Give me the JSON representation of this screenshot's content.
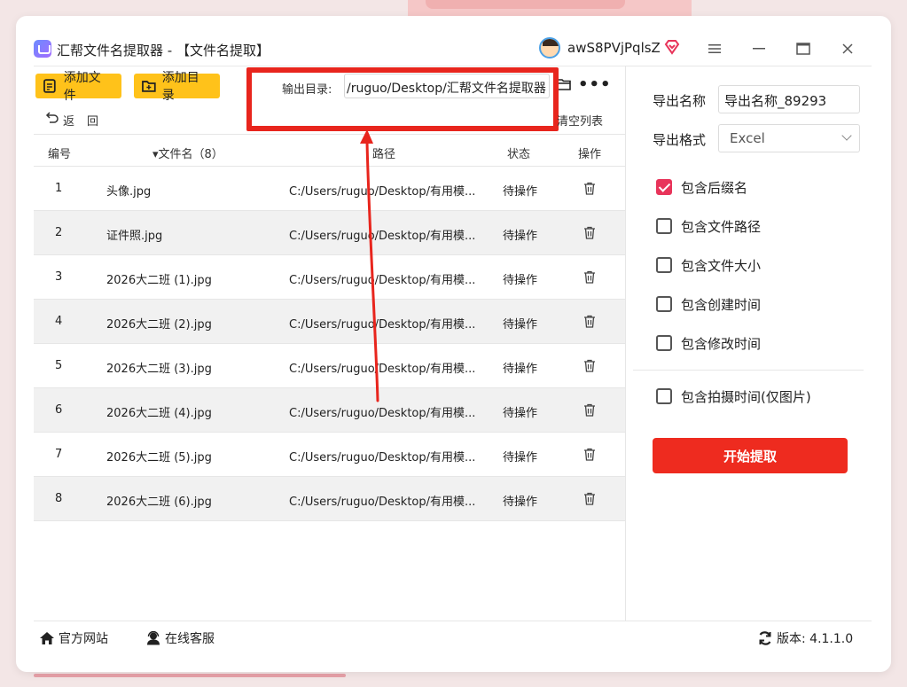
{
  "window": {
    "title": "汇帮文件名提取器 - 【文件名提取】",
    "username": "awS8PVjPqlsZ"
  },
  "toolbar": {
    "add_file": "添加文件",
    "add_dir": "添加目录",
    "output_label": "输出目录:",
    "output_value": "/ruguo/Desktop/汇帮文件名提取器",
    "more": "•••",
    "back": "返回",
    "clear_list": "清空列表"
  },
  "table": {
    "headers": {
      "no": "编号",
      "name": "▾文件名（8）",
      "path": "路径",
      "status": "状态",
      "op": "操作"
    },
    "rows": [
      {
        "no": "1",
        "name": "头像.jpg",
        "path": "C:/Users/ruguo/Desktop/有用模...",
        "status": "待操作"
      },
      {
        "no": "2",
        "name": "证件照.jpg",
        "path": "C:/Users/ruguo/Desktop/有用模...",
        "status": "待操作"
      },
      {
        "no": "3",
        "name": "2026大二班 (1).jpg",
        "path": "C:/Users/ruguo/Desktop/有用模...",
        "status": "待操作"
      },
      {
        "no": "4",
        "name": "2026大二班 (2).jpg",
        "path": "C:/Users/ruguo/Desktop/有用模...",
        "status": "待操作"
      },
      {
        "no": "5",
        "name": "2026大二班 (3).jpg",
        "path": "C:/Users/ruguo/Desktop/有用模...",
        "status": "待操作"
      },
      {
        "no": "6",
        "name": "2026大二班 (4).jpg",
        "path": "C:/Users/ruguo/Desktop/有用模...",
        "status": "待操作"
      },
      {
        "no": "7",
        "name": "2026大二班 (5).jpg",
        "path": "C:/Users/ruguo/Desktop/有用模...",
        "status": "待操作"
      },
      {
        "no": "8",
        "name": "2026大二班 (6).jpg",
        "path": "C:/Users/ruguo/Desktop/有用模...",
        "status": "待操作"
      }
    ]
  },
  "settings": {
    "export_name_label": "导出名称",
    "export_name_value": "导出名称_89293",
    "export_format_label": "导出格式",
    "export_format_value": "Excel",
    "options": [
      {
        "label": "包含后缀名",
        "checked": true
      },
      {
        "label": "包含文件路径",
        "checked": false
      },
      {
        "label": "包含文件大小",
        "checked": false
      },
      {
        "label": "包含创建时间",
        "checked": false
      },
      {
        "label": "包含修改时间",
        "checked": false
      }
    ],
    "photo_option": {
      "label": "包含拍摄时间(仅图片)",
      "checked": false
    },
    "start_button": "开始提取"
  },
  "footer": {
    "website": "官方网站",
    "support": "在线客服",
    "version": "版本: 4.1.1.0"
  },
  "colors": {
    "accent_yellow": "#ffc21a",
    "start_red": "#ee2b1f",
    "check_pink": "#e8345a",
    "annotation_red": "#e8251d"
  }
}
